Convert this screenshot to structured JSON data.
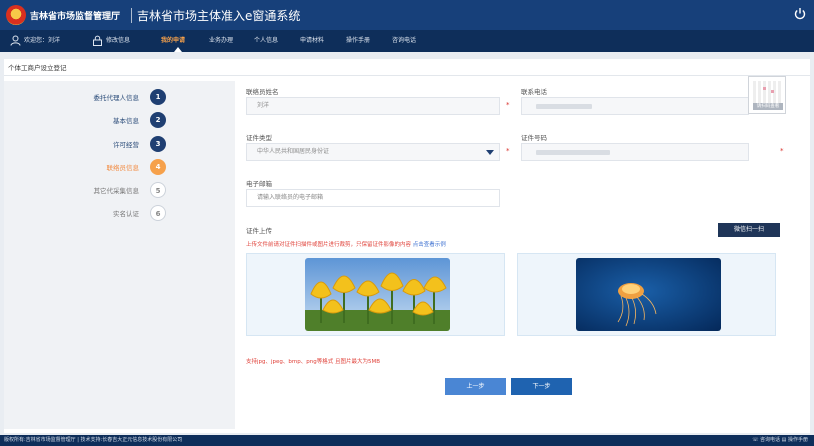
{
  "header": {
    "org_name": "吉林省市场监督管理厅",
    "system_title": "吉林省市场主体准入e窗通系统"
  },
  "nav": {
    "welcome": "欢迎您：刘洋",
    "change_info": "修改信息",
    "items": [
      "我的申请",
      "业务办理",
      "个人信息",
      "申请材料",
      "操作手册",
      "咨询电话"
    ],
    "active_index": 0
  },
  "page": {
    "title": "个体工商户设立登记"
  },
  "steps": [
    {
      "label": "委托代理人信息",
      "num": "1",
      "state": "done"
    },
    {
      "label": "基本信息",
      "num": "2",
      "state": "done"
    },
    {
      "label": "许可经营",
      "num": "3",
      "state": "done"
    },
    {
      "label": "联络员信息",
      "num": "4",
      "state": "current"
    },
    {
      "label": "其它代采集信息",
      "num": "5",
      "state": "todo"
    },
    {
      "label": "实名认证",
      "num": "6",
      "state": "todo"
    }
  ],
  "form": {
    "contact_name_label": "联络员姓名",
    "contact_name_value": "刘洋",
    "contact_phone_label": "联系电话",
    "id_type_label": "证件类型",
    "id_type_value": "中华人民共和国居民身份证",
    "id_number_label": "证件号码",
    "email_label": "电子邮箱",
    "email_placeholder": "请输入联络员的电子邮箱",
    "upload_label": "证件上传",
    "wechat_button": "微信扫一扫",
    "notice_text": "上传文件前请对证件扫描件或图片进行裁剪，只保留证件影像的内容",
    "notice_link": "点击查看示例",
    "formats_text": "支持jpg、jpeg、bmp、png等格式 且图片最大为5MB",
    "prev_button": "上一步",
    "next_button": "下一步",
    "qr_caption": "请扫码查看"
  },
  "colors": {
    "header_bg": "#17407a",
    "nav_bg": "#0e2e5a",
    "active_nav": "#f6a14b",
    "step_done": "#1f3f72",
    "step_current": "#f6a14b",
    "required": "#d9302b"
  },
  "icons": {
    "logo": "emblem-icon",
    "power": "power-icon",
    "user": "user-icon",
    "lock": "lock-icon",
    "select": "chevron-down-icon",
    "phone": "phone-icon",
    "manual": "book-icon"
  },
  "footer": {
    "left": "版权所有:吉林省市场监督管理厅 | 技术支持:长春吉大正元信息技术股份有限公司",
    "hotline": "咨询电话",
    "manual": "操作手册"
  }
}
